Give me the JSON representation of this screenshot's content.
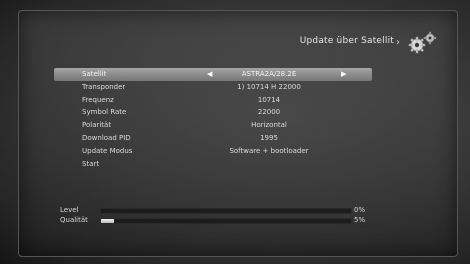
{
  "header": {
    "title": "Update über Satellit",
    "icon": "gears-icon"
  },
  "menu": {
    "rows": [
      {
        "label": "Satellit",
        "value": "ASTRA2A/28.2E",
        "selected": true
      },
      {
        "label": "Transponder",
        "value": "1) 10714 H 22000"
      },
      {
        "label": "Frequenz",
        "value": "10714"
      },
      {
        "label": "Symbol Rate",
        "value": "22000"
      },
      {
        "label": "Polarität",
        "value": "Horizontal"
      },
      {
        "label": "Download PID",
        "value": "1995"
      },
      {
        "label": "Update Modus",
        "value": "Software + bootloader"
      },
      {
        "label": "Start",
        "value": ""
      }
    ],
    "arrow_left": "◀",
    "arrow_right": "▶"
  },
  "signal": {
    "level": {
      "label": "Level",
      "value": "0%",
      "fraction": 0.0
    },
    "quality": {
      "label": "Qualität",
      "value": "5%",
      "fraction": 0.05
    }
  },
  "colors": {
    "selected_row": "#8f8f8f",
    "bar_fill": "#e6e6e6",
    "bar_track": "#1c1c1c"
  }
}
